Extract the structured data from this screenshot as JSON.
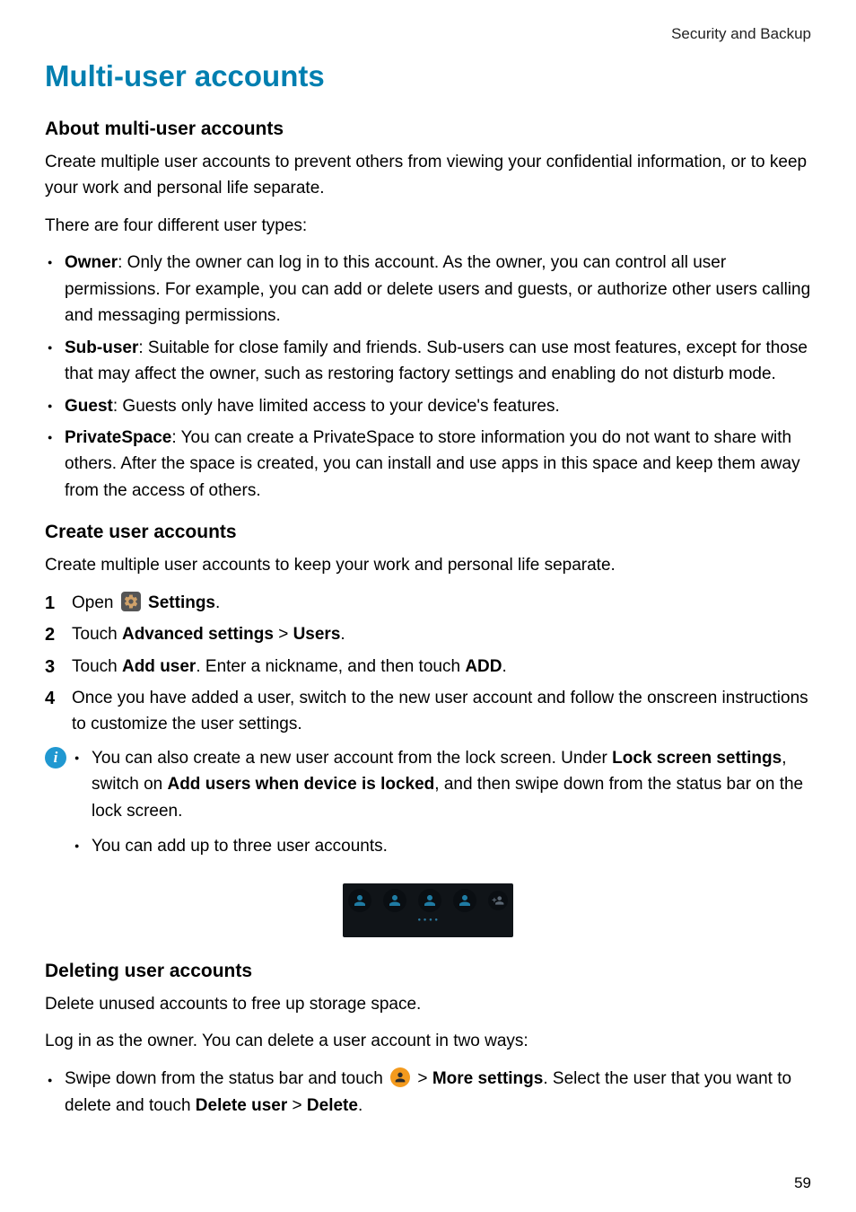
{
  "running_header": "Security and Backup",
  "title": "Multi-user accounts",
  "about": {
    "heading": "About multi-user accounts",
    "p1": "Create multiple user accounts to prevent others from viewing your confidential information, or to keep your work and personal life separate.",
    "p2": "There are four different user types:",
    "types": [
      {
        "name": "Owner",
        "desc": ": Only the owner can log in to this account. As the owner, you can control all user permissions. For example, you can add or delete users and guests, or authorize other users calling and messaging permissions."
      },
      {
        "name": "Sub-user",
        "desc": ": Suitable for close family and friends. Sub-users can use most features, except for those that may affect the owner, such as restoring factory settings and enabling do not disturb mode."
      },
      {
        "name": "Guest",
        "desc": ": Guests only have limited access to your device's features."
      },
      {
        "name": "PrivateSpace",
        "desc": ": You can create a PrivateSpace to store information you do not want to share with others. After the space is created, you can install and use apps in this space and keep them away from the access of others."
      }
    ]
  },
  "create": {
    "heading": "Create user accounts",
    "p1": "Create multiple user accounts to keep your work and personal life separate.",
    "steps": {
      "s1_open": "Open ",
      "s1_settings": " Settings",
      "s1_end": ".",
      "s2_touch": "Touch ",
      "s2_adv": "Advanced settings",
      "s2_gt": " > ",
      "s2_users": "Users",
      "s2_end": ".",
      "s3_touch": "Touch ",
      "s3_adduser": "Add user",
      "s3_mid": ". Enter a nickname, and then touch ",
      "s3_add": "ADD",
      "s3_end": ".",
      "s4": "Once you have added a user, switch to the new user account and follow the onscreen instructions to customize the user settings."
    },
    "info": {
      "tip1_a": "You can also create a new user account from the lock screen. Under ",
      "tip1_b": "Lock screen settings",
      "tip1_c": ", switch on ",
      "tip1_d": "Add users when device is locked",
      "tip1_e": ", and then swipe down from the status bar on the lock screen.",
      "tip2": "You can add up to three user accounts."
    }
  },
  "figure": {
    "bottom_text": "● ● ● ●"
  },
  "deleting": {
    "heading": "Deleting user accounts",
    "p1": "Delete unused accounts to free up storage space.",
    "p2": "Log in as the owner. You can delete a user account in two ways:",
    "item1_a": "Swipe down from the status bar and touch ",
    "item1_b": " > ",
    "item1_c": "More settings",
    "item1_d": ". Select the user that you want to delete and touch ",
    "item1_e": "Delete user",
    "item1_f": " > ",
    "item1_g": "Delete",
    "item1_h": "."
  },
  "page_number": "59"
}
